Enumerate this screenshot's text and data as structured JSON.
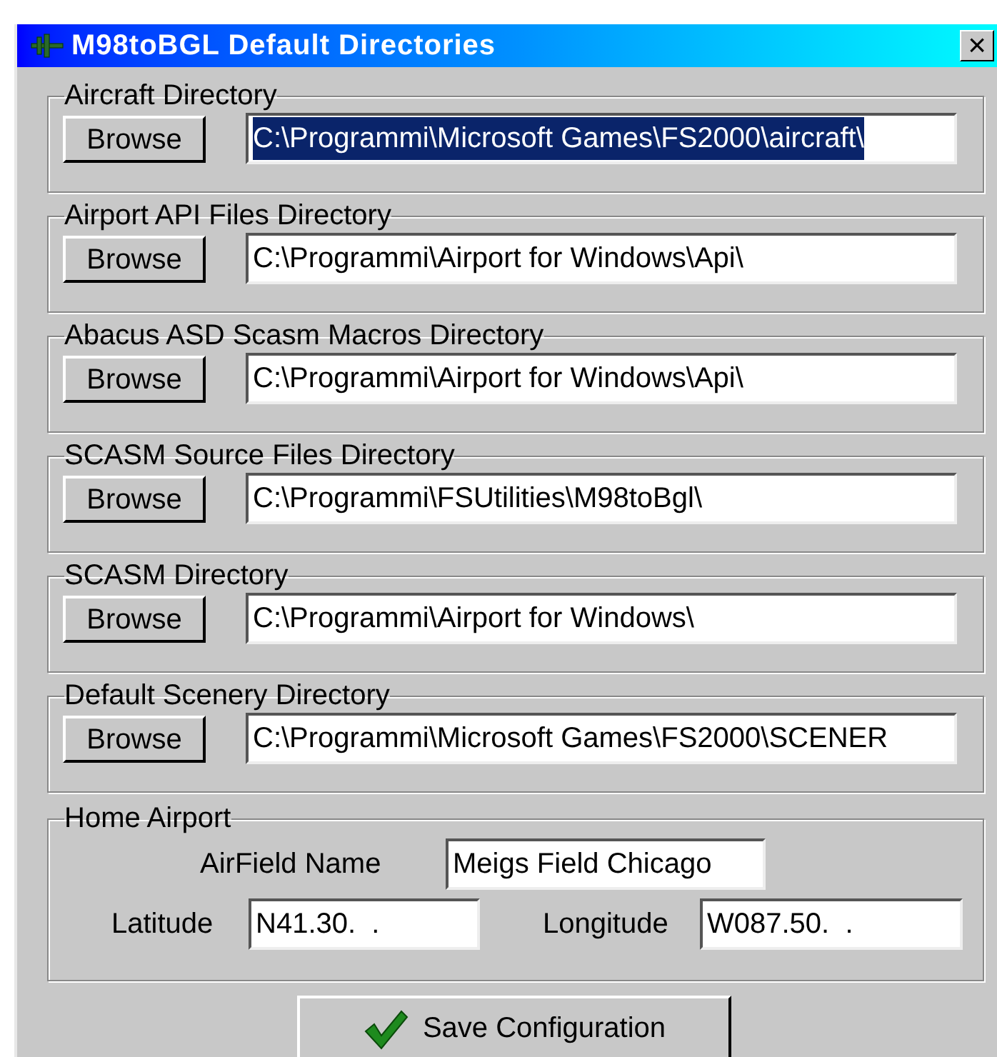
{
  "window": {
    "title": "M98toBGL Default Directories",
    "close": "×"
  },
  "directories": [
    {
      "label": "Aircraft Directory",
      "button": "Browse",
      "value": "C:\\Programmi\\Microsoft Games\\FS2000\\aircraft\\",
      "selected": true
    },
    {
      "label": "Airport API Files Directory",
      "button": "Browse",
      "value": "C:\\Programmi\\Airport for Windows\\Api\\",
      "selected": false
    },
    {
      "label": "Abacus ASD Scasm Macros Directory",
      "button": "Browse",
      "value": "C:\\Programmi\\Airport for Windows\\Api\\",
      "selected": false
    },
    {
      "label": "SCASM Source Files Directory",
      "button": "Browse",
      "value": "C:\\Programmi\\FSUtilities\\M98toBgl\\",
      "selected": false
    },
    {
      "label": "SCASM Directory",
      "button": "Browse",
      "value": "C:\\Programmi\\Airport for Windows\\",
      "selected": false
    },
    {
      "label": "Default Scenery Directory",
      "button": "Browse",
      "value": "C:\\Programmi\\Microsoft Games\\FS2000\\SCENER",
      "selected": false
    }
  ],
  "home_airport": {
    "label": "Home Airport",
    "airfield_name": {
      "label": "AirField Name",
      "value": "Meigs Field Chicago"
    },
    "latitude": {
      "label": "Latitude",
      "value": "N41.30.  ."
    },
    "longitude": {
      "label": "Longitude",
      "value": "W087.50.  ."
    }
  },
  "save_button": "Save Configuration"
}
